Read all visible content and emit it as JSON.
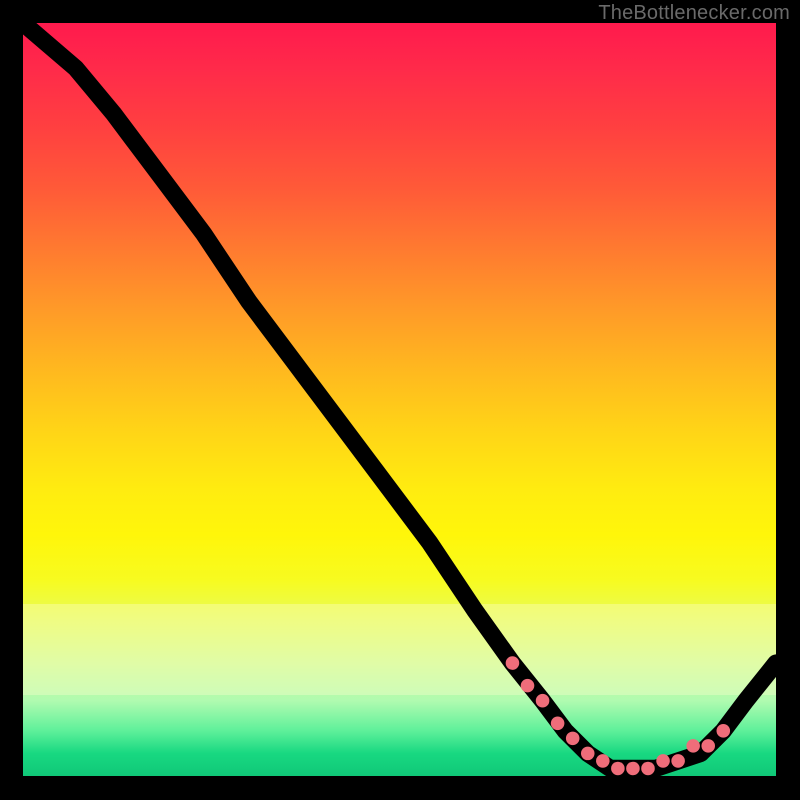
{
  "watermark": "TheBottlenecker.com",
  "chart_data": {
    "type": "line",
    "title": "",
    "xlabel": "",
    "ylabel": "",
    "xlim": [
      0,
      100
    ],
    "ylim": [
      0,
      100
    ],
    "series": [
      {
        "name": "bottleneck-curve",
        "x": [
          0,
          7,
          12,
          18,
          24,
          30,
          36,
          42,
          48,
          54,
          60,
          65,
          69,
          72,
          75,
          78,
          81,
          84,
          87,
          90,
          93,
          96,
          100
        ],
        "y": [
          100,
          94,
          88,
          80,
          72,
          63,
          55,
          47,
          39,
          31,
          22,
          15,
          10,
          6,
          3,
          1,
          1,
          1,
          2,
          3,
          6,
          10,
          15
        ]
      }
    ],
    "markers": {
      "name": "optimal-range-markers",
      "x": [
        65,
        67,
        69,
        71,
        73,
        75,
        77,
        79,
        81,
        83,
        85,
        87,
        89,
        91,
        93
      ],
      "y": [
        15,
        12,
        10,
        7,
        5,
        3,
        2,
        1,
        1,
        1,
        2,
        2,
        4,
        4,
        6
      ]
    }
  },
  "colors": {
    "marker": "#ef6d7a",
    "curve": "#000000"
  }
}
